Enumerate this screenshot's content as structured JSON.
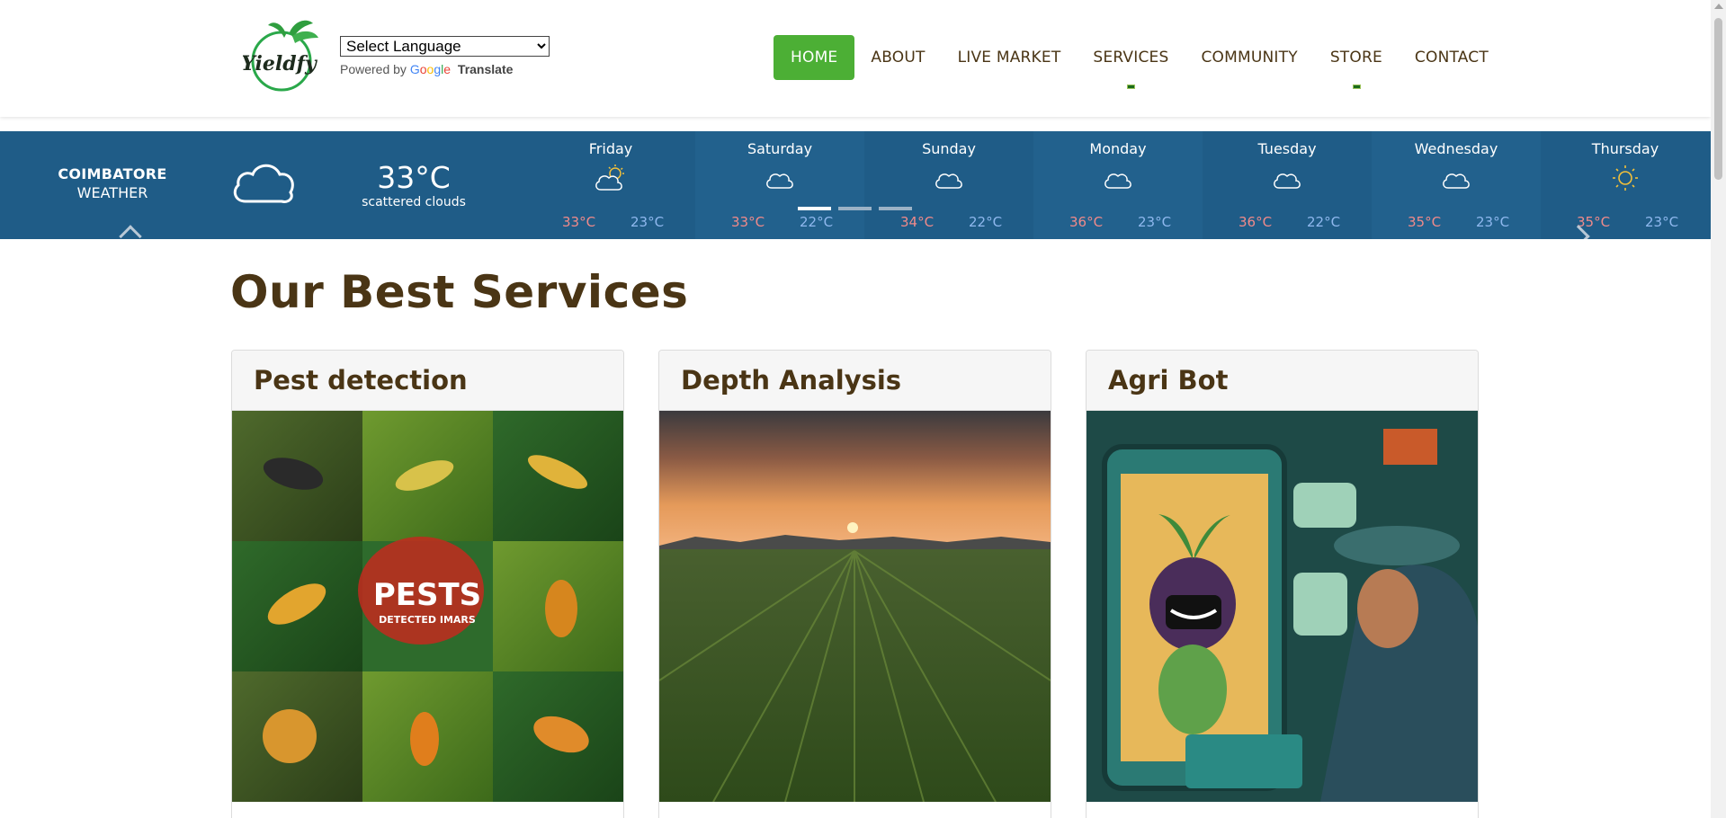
{
  "header": {
    "logo_alt": "Yieldify",
    "translate": {
      "select_value": "Select Language",
      "powered_by": "Powered by",
      "google_letters": [
        "G",
        "o",
        "o",
        "g",
        "l",
        "e"
      ],
      "translate_label": "Translate"
    },
    "nav": [
      {
        "label": "HOME",
        "active": true
      },
      {
        "label": "ABOUT"
      },
      {
        "label": "LIVE MARKET"
      },
      {
        "label": "SERVICES",
        "has_dropdown": true
      },
      {
        "label": "COMMUNITY"
      },
      {
        "label": "STORE",
        "has_dropdown": true
      },
      {
        "label": "CONTACT"
      }
    ]
  },
  "weather": {
    "city": "COIMBATORE",
    "label": "WEATHER",
    "current_temp": "33°C",
    "current_desc": "scattered clouds",
    "current_icon": "cloud-icon",
    "days": [
      {
        "name": "Friday",
        "icon": "partly-sunny-icon",
        "hi": "33°C",
        "lo": "23°C"
      },
      {
        "name": "Saturday",
        "icon": "cloud-icon",
        "hi": "33°C",
        "lo": "22°C"
      },
      {
        "name": "Sunday",
        "icon": "cloud-icon",
        "hi": "34°C",
        "lo": "22°C"
      },
      {
        "name": "Monday",
        "icon": "cloud-icon",
        "hi": "36°C",
        "lo": "23°C"
      },
      {
        "name": "Tuesday",
        "icon": "cloud-icon",
        "hi": "36°C",
        "lo": "22°C"
      },
      {
        "name": "Wednesday",
        "icon": "cloud-icon",
        "hi": "35°C",
        "lo": "23°C"
      },
      {
        "name": "Thursday",
        "icon": "sun-icon",
        "hi": "35°C",
        "lo": "23°C"
      }
    ],
    "carousel_active_index": 0,
    "carousel_count": 3
  },
  "services": {
    "title": "Our Best Services",
    "cards": [
      {
        "title": "Pest detection",
        "image": "pest-collage-image",
        "overlay_text": "PESTS",
        "overlay_sub": "DETECTED IMARS"
      },
      {
        "title": "Depth Analysis",
        "image": "field-sunset-image"
      },
      {
        "title": "Agri Bot",
        "image": "robot-farmer-image"
      }
    ]
  },
  "colors": {
    "brand_green": "#4caf35",
    "weather_bg": "#1f5c87",
    "heading_brown": "#4a3515",
    "temp_high": "#f08a8a",
    "temp_low": "#8fb8ee"
  }
}
